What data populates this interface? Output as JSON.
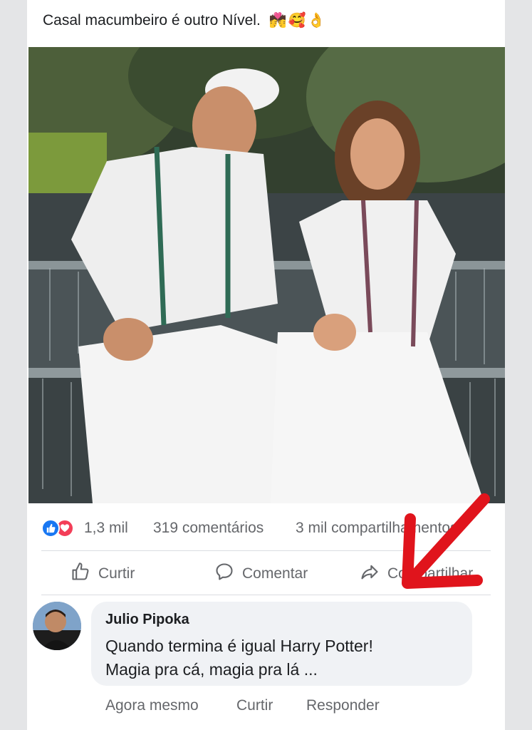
{
  "post": {
    "caption": "Casal macumbeiro é outro Nível.",
    "caption_emoji": "💏🥰👌"
  },
  "photo": {
    "alt": "couple in white clothes sitting by waterfall"
  },
  "stats": {
    "reaction_count": "1,3 mil",
    "comments": "319 comentários",
    "shares": "3 mil compartilhamentos"
  },
  "actions": {
    "like": "Curtir",
    "comment": "Comentar",
    "share": "Compartilhar"
  },
  "comment": {
    "author": "Julio Pipoka",
    "line1": "Quando termina é igual Harry Potter!",
    "line2": "Magia pra cá, magia pra lá ...",
    "time": "Agora mesmo",
    "like": "Curtir",
    "reply": "Responder"
  },
  "colors": {
    "like_blue": "#1877f2",
    "love_red": "#f33e58",
    "arrow_red": "#e0141c",
    "muted_text": "#65676b"
  },
  "icons": [
    "like-reaction-icon",
    "love-reaction-icon",
    "thumbs-up-icon",
    "comment-icon",
    "share-icon"
  ]
}
